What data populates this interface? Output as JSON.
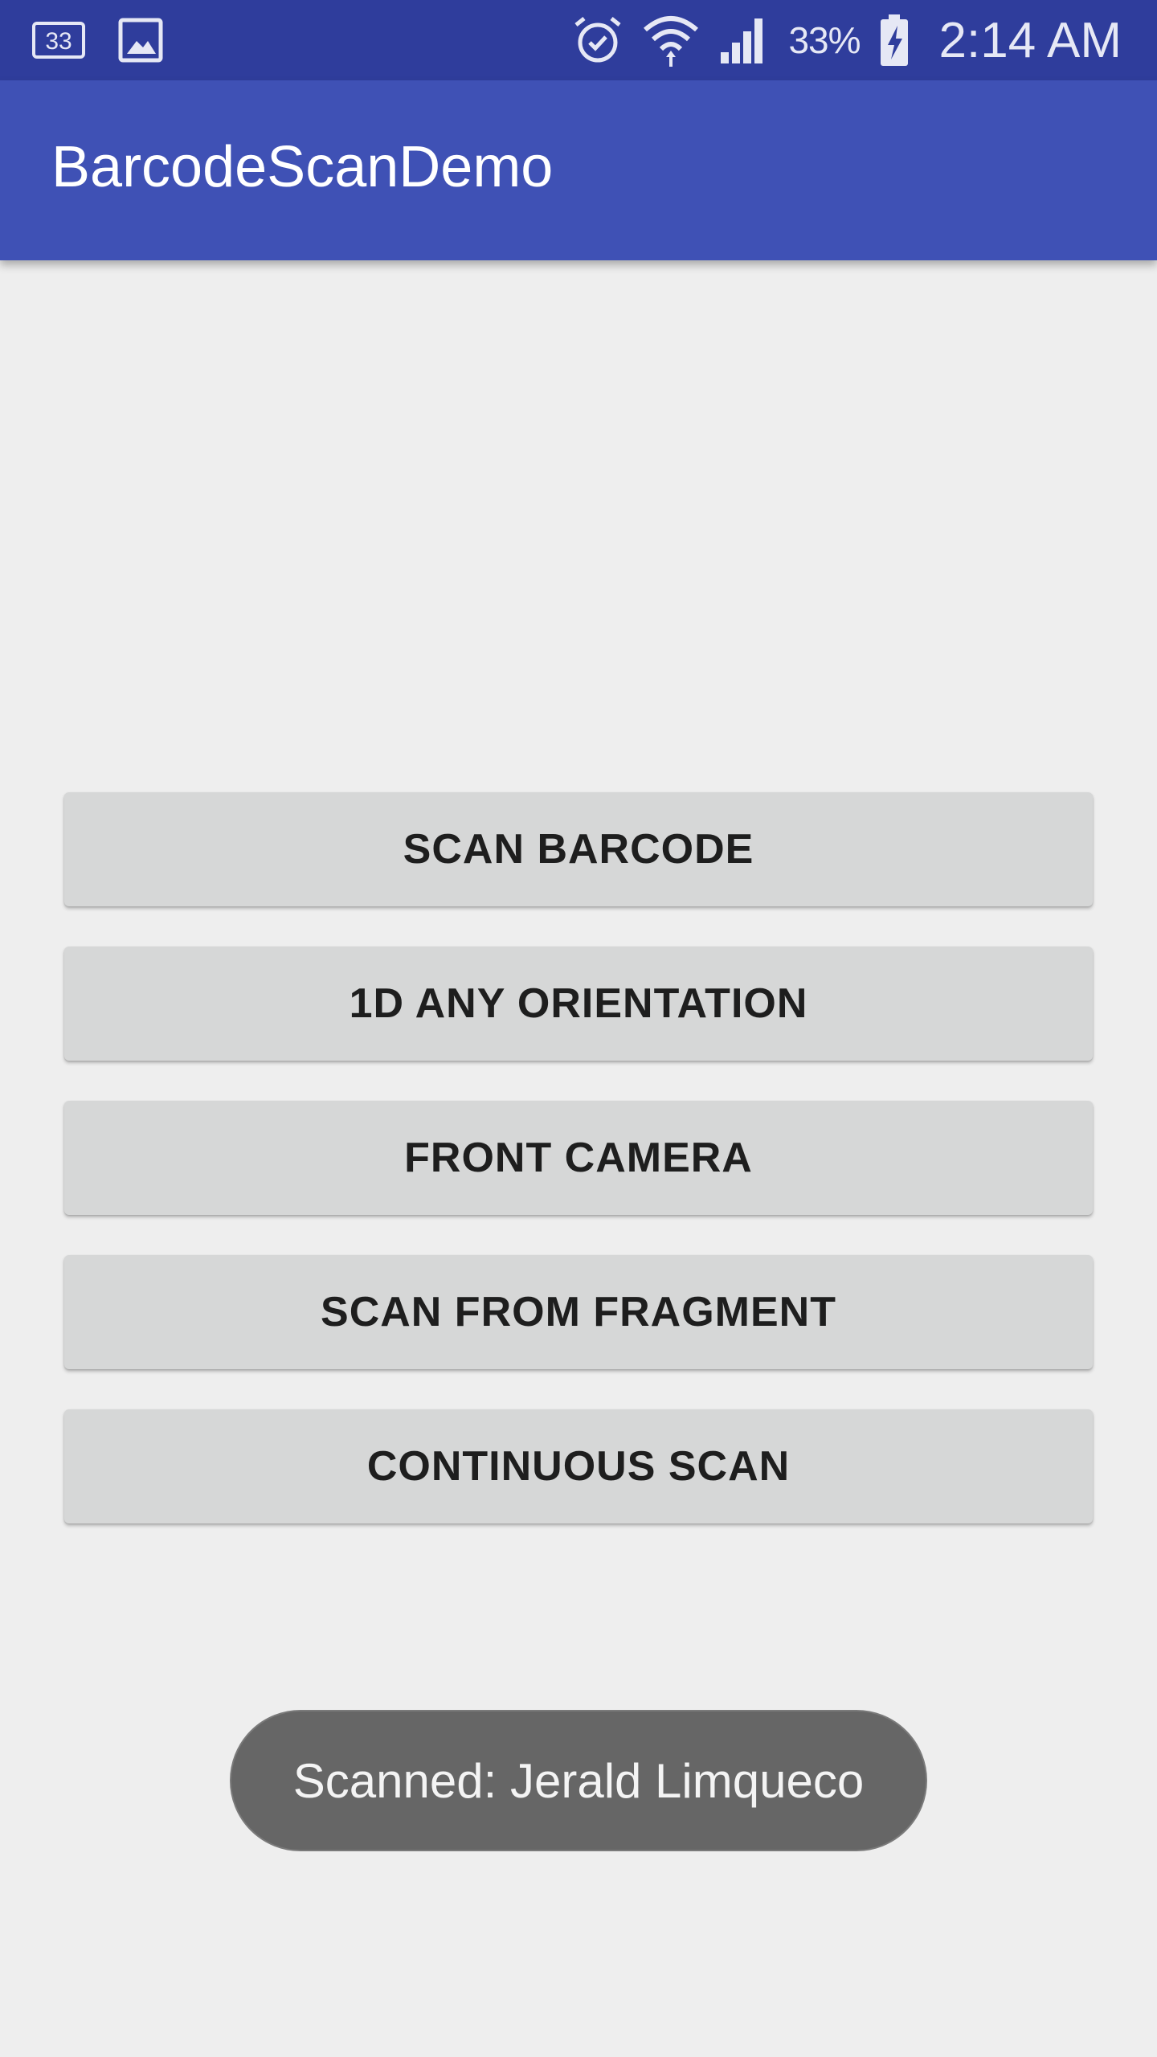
{
  "status_bar": {
    "notification_badge": "33",
    "battery_percent": "33%",
    "time": "2:14 AM",
    "icons": [
      "calendar-icon",
      "image-icon",
      "alarm-icon",
      "wifi-icon",
      "signal-icon",
      "battery-charging-icon"
    ]
  },
  "app_bar": {
    "title": "BarcodeScanDemo",
    "color": "#3f51b5"
  },
  "buttons": [
    {
      "label": "SCAN BARCODE"
    },
    {
      "label": "1D ANY ORIENTATION"
    },
    {
      "label": "FRONT CAMERA"
    },
    {
      "label": "SCAN FROM FRAGMENT"
    },
    {
      "label": "CONTINUOUS SCAN"
    }
  ],
  "toast": {
    "text": "Scanned: Jerald Limqueco"
  }
}
